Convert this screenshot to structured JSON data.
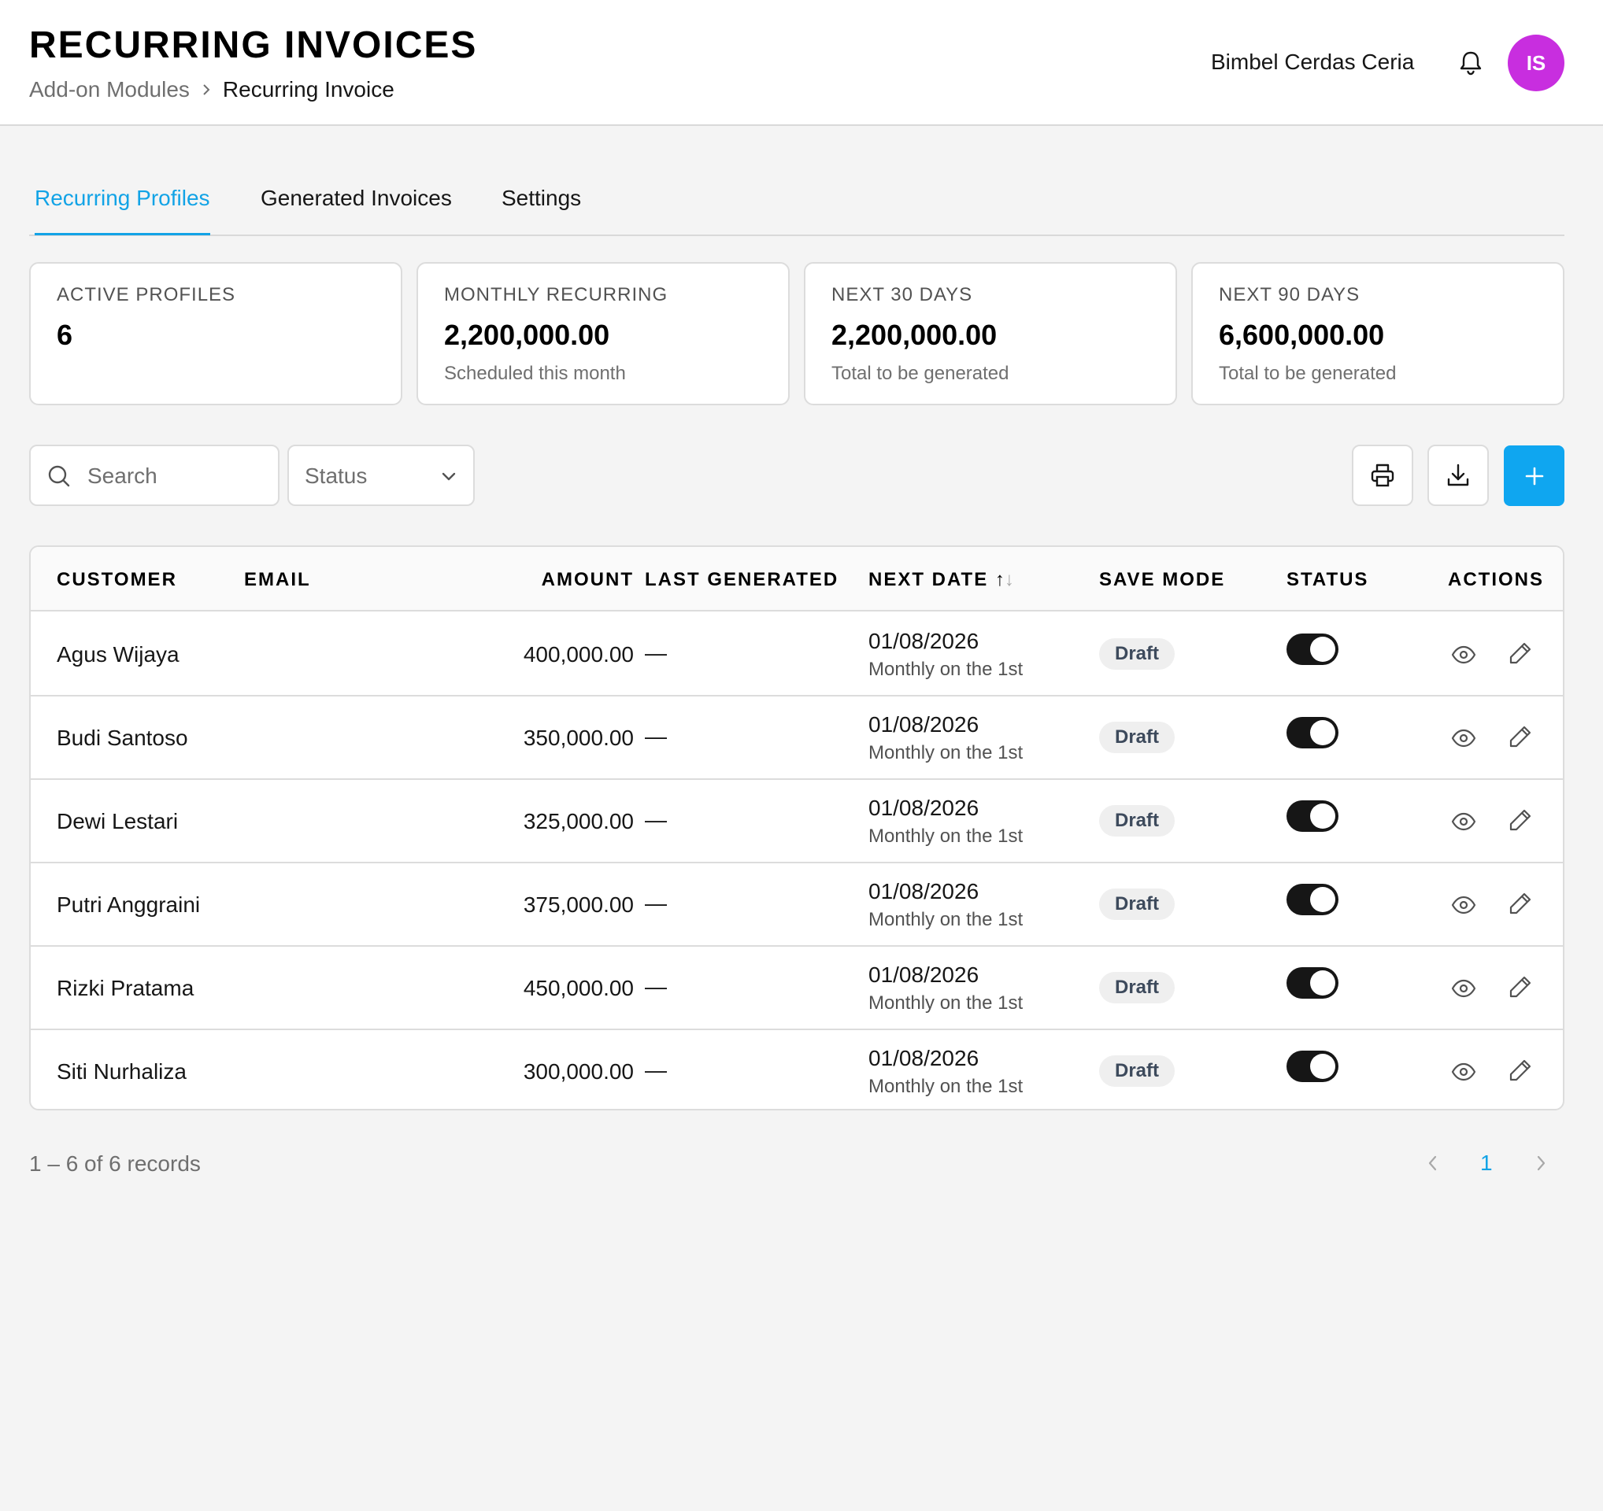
{
  "header": {
    "title": "RECURRING INVOICES",
    "breadcrumb": {
      "parent": "Add-on Modules",
      "current": "Recurring Invoice"
    },
    "org_name": "Bimbel Cerdas Ceria",
    "avatar_initials": "IS",
    "avatar_color": "#c82edf"
  },
  "tabs": [
    {
      "label": "Recurring Profiles",
      "active": true
    },
    {
      "label": "Generated Invoices",
      "active": false
    },
    {
      "label": "Settings",
      "active": false
    }
  ],
  "stats": [
    {
      "label": "ACTIVE PROFILES",
      "value": "6",
      "sub": ""
    },
    {
      "label": "MONTHLY RECURRING",
      "value": "2,200,000.00",
      "sub": "Scheduled this month"
    },
    {
      "label": "NEXT 30 DAYS",
      "value": "2,200,000.00",
      "sub": "Total to be generated"
    },
    {
      "label": "NEXT 90 DAYS",
      "value": "6,600,000.00",
      "sub": "Total to be generated"
    }
  ],
  "toolbar": {
    "search_placeholder": "Search",
    "search_value": "",
    "status_placeholder": "Status",
    "icons": [
      "search-icon",
      "chevron-down-icon",
      "printer-icon",
      "download-icon",
      "plus-icon"
    ],
    "accent_color": "#0fa6f0"
  },
  "table": {
    "columns": {
      "customer": "CUSTOMER",
      "email": "EMAIL",
      "amount": "AMOUNT",
      "last_generated": "LAST GENERATED",
      "next_date": "NEXT DATE",
      "sort_up": "↑",
      "sort_down": "↓",
      "save_mode": "SAVE MODE",
      "status": "STATUS",
      "actions": "ACTIONS"
    },
    "rows": [
      {
        "customer": "Agus Wijaya",
        "email": "",
        "amount": "400,000.00",
        "last_generated": "—",
        "next_date": "01/08/2026",
        "frequency": "Monthly on the 1st",
        "save_mode": "Draft",
        "active": true
      },
      {
        "customer": "Budi Santoso",
        "email": "",
        "amount": "350,000.00",
        "last_generated": "—",
        "next_date": "01/08/2026",
        "frequency": "Monthly on the 1st",
        "save_mode": "Draft",
        "active": true
      },
      {
        "customer": "Dewi Lestari",
        "email": "",
        "amount": "325,000.00",
        "last_generated": "—",
        "next_date": "01/08/2026",
        "frequency": "Monthly on the 1st",
        "save_mode": "Draft",
        "active": true
      },
      {
        "customer": "Putri Anggraini",
        "email": "",
        "amount": "375,000.00",
        "last_generated": "—",
        "next_date": "01/08/2026",
        "frequency": "Monthly on the 1st",
        "save_mode": "Draft",
        "active": true
      },
      {
        "customer": "Rizki Pratama",
        "email": "",
        "amount": "450,000.00",
        "last_generated": "—",
        "next_date": "01/08/2026",
        "frequency": "Monthly on the 1st",
        "save_mode": "Draft",
        "active": true
      },
      {
        "customer": "Siti Nurhaliza",
        "email": "",
        "amount": "300,000.00",
        "last_generated": "—",
        "next_date": "01/08/2026",
        "frequency": "Monthly on the 1st",
        "save_mode": "Draft",
        "active": true
      }
    ]
  },
  "pagination": {
    "records_text": "1 – 6 of 6 records",
    "current_page": "1"
  }
}
